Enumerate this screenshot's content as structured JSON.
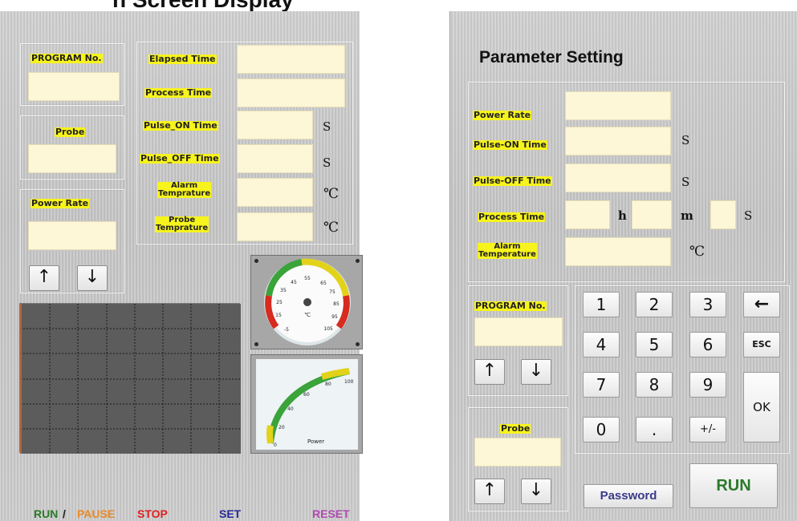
{
  "header_banner": "n Screen Display",
  "left": {
    "program_label": "PROGRAM No.",
    "probe_label": "Probe",
    "power_rate_label": "Power Rate",
    "elapsed_time_label": "Elapsed Time",
    "process_time_label": "Process Time",
    "pulse_on_label": "Pulse_ON Time",
    "pulse_off_label": "Pulse_OFF Time",
    "alarm_temp_label_1": "Alarm",
    "alarm_temp_label_2": "Temprature",
    "probe_temp_label_1": "Probe",
    "probe_temp_label_2": "Temprature",
    "unit_s": "S",
    "unit_c": "℃",
    "up_arrow": "↑",
    "down_arrow": "↓",
    "thermo_gauge": {
      "unit": "℃",
      "ticks": [
        "-5",
        "15",
        "25",
        "35",
        "45",
        "55",
        "65",
        "75",
        "85",
        "95",
        "105"
      ]
    },
    "power_gauge": {
      "label": "Power",
      "ticks": [
        "0",
        "20",
        "40",
        "60",
        "80",
        "100"
      ]
    },
    "bottom": {
      "run": "RUN",
      "slash": " /",
      "pause": "PAUSE",
      "stop": "STOP",
      "set": "SET",
      "reset": "RESET"
    }
  },
  "right": {
    "title": "Parameter Setting",
    "power_rate_label": "Power Rate",
    "pulse_on_label": "Pulse-ON Time",
    "pulse_off_label": "Pulse-OFF Time",
    "process_time_label": "Process Time",
    "alarm_temp_label_1": "Alarm",
    "alarm_temp_label_2": "Temperature",
    "unit_s": "S",
    "unit_h": "h",
    "unit_m": "m",
    "unit_c": "℃",
    "program_label": "PROGRAM No.",
    "probe_label": "Probe",
    "up_arrow": "↑",
    "down_arrow": "↓",
    "keypad": [
      "1",
      "2",
      "3",
      "←",
      "4",
      "5",
      "6",
      "ESC",
      "7",
      "8",
      "9",
      "0",
      ".",
      "+/-"
    ],
    "ok": "OK",
    "password": "Password",
    "run": "RUN"
  }
}
